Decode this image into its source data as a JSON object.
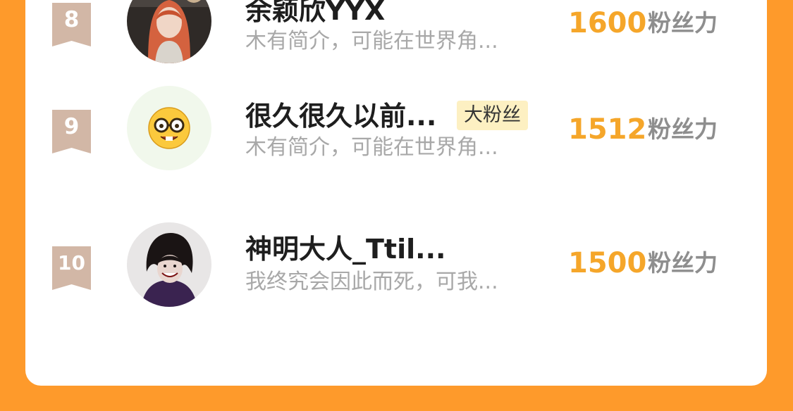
{
  "colors": {
    "background": "#fe9a2b",
    "card": "#ffffff",
    "score": "#f5a62a",
    "rank_badge": "#d2b7a6",
    "badge_bg": "#fdf0c2"
  },
  "score_unit": "粉丝力",
  "ranking": [
    {
      "rank": "8",
      "name": "余颖欣YYX",
      "badge": "",
      "description": "木有简介，可能在世界角...",
      "score": "1600",
      "avatar": "photo-avatar-red-hair"
    },
    {
      "rank": "9",
      "name": "很久很久以前...",
      "badge": "大粉丝",
      "description": "木有简介，可能在世界角...",
      "score": "1512",
      "avatar": "nerd-face-emoji-avatar"
    },
    {
      "rank": "10",
      "name": "神明大人_Ttil...",
      "badge": "",
      "description": "我终究会因此而死，可我...",
      "score": "1500",
      "avatar": "anime-character-avatar"
    }
  ]
}
